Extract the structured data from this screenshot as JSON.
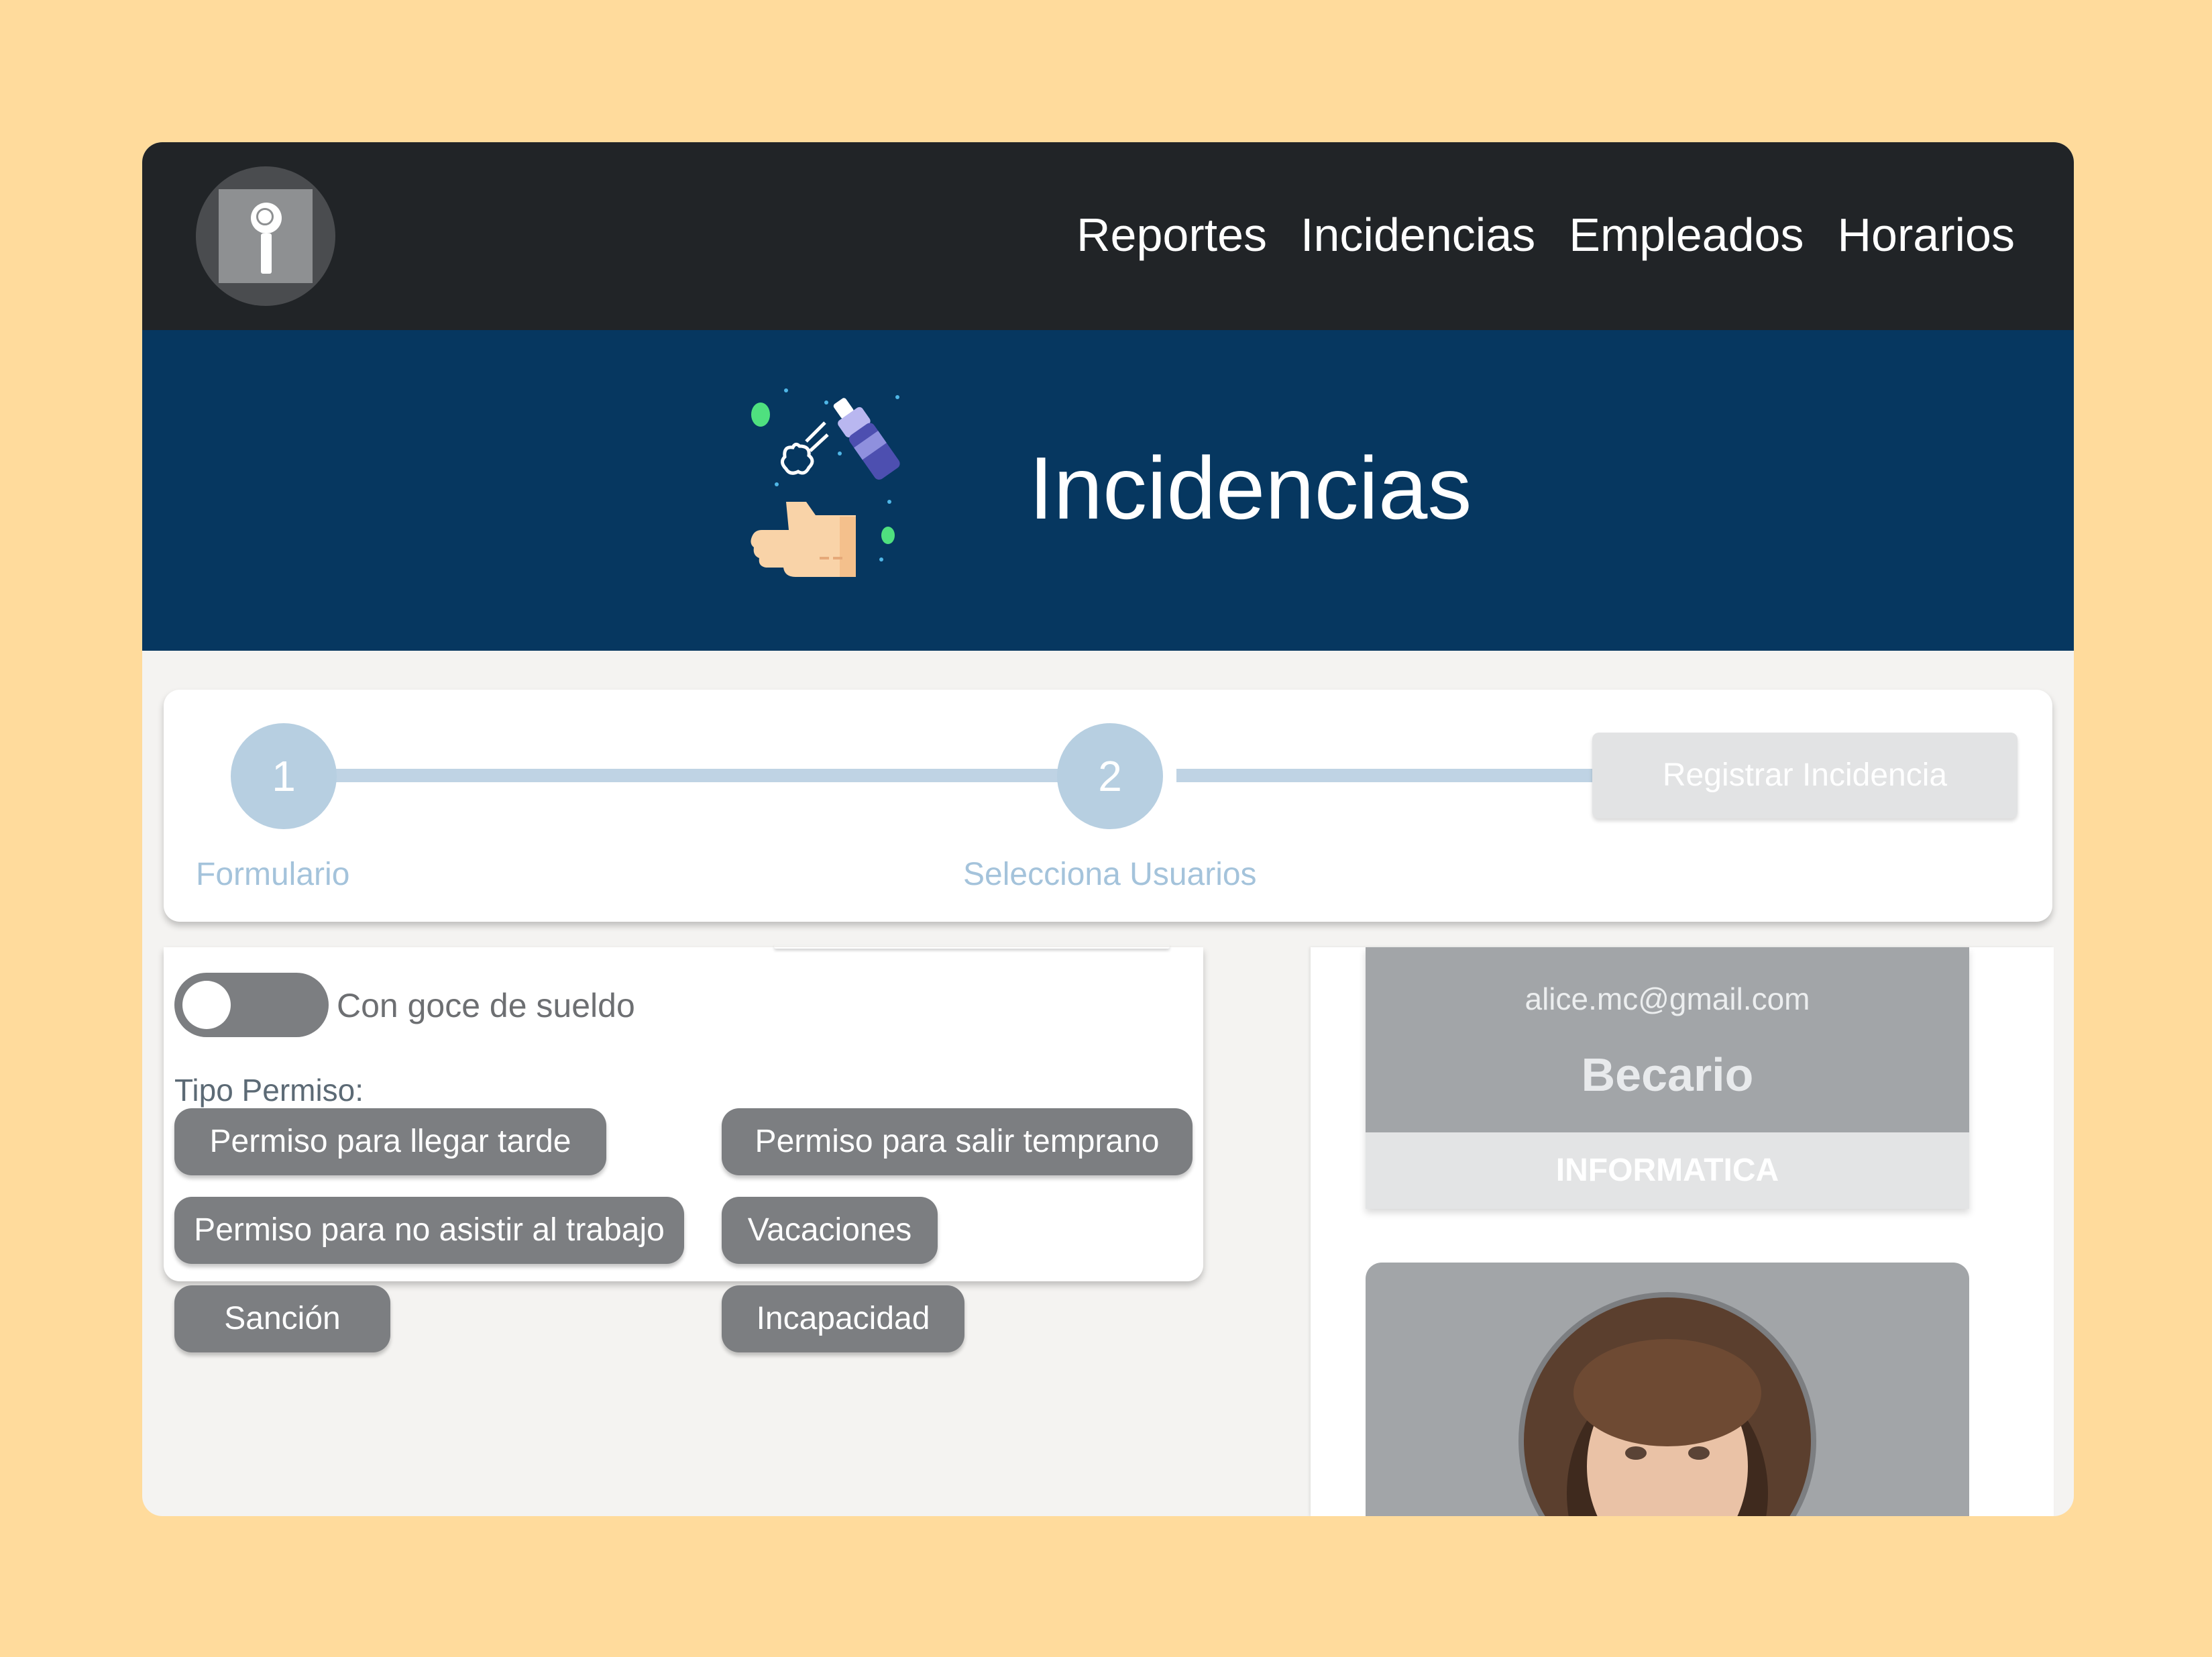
{
  "nav": {
    "items": [
      "Reportes",
      "Incidencias",
      "Empleados",
      "Horarios"
    ]
  },
  "hero": {
    "title": "Incidencias",
    "icon": "hand-sanitizer-icon"
  },
  "stepper": {
    "steps": [
      {
        "number": "1",
        "label": "Formulario"
      },
      {
        "number": "2",
        "label": "Selecciona Usuarios"
      }
    ],
    "register_label": "Registrar Incidencia"
  },
  "form": {
    "toggle_label": "Con goce de sueldo",
    "toggle_on": false,
    "tipo_label": "Tipo Permiso:",
    "chips": [
      "Permiso para llegar tarde",
      "Permiso para salir temprano",
      "Permiso para no asistir al trabajo",
      "Vacaciones",
      "Sanción",
      "Incapacidad"
    ]
  },
  "user_card": {
    "email": "alice.mc@gmail.com",
    "role": "Becario",
    "department": "INFORMATICA"
  },
  "colors": {
    "page_bg": "#FFDB9C",
    "topbar": "#212427",
    "hero": "#063760",
    "step": "#B7CFE1",
    "chip": "#7C7E81"
  }
}
